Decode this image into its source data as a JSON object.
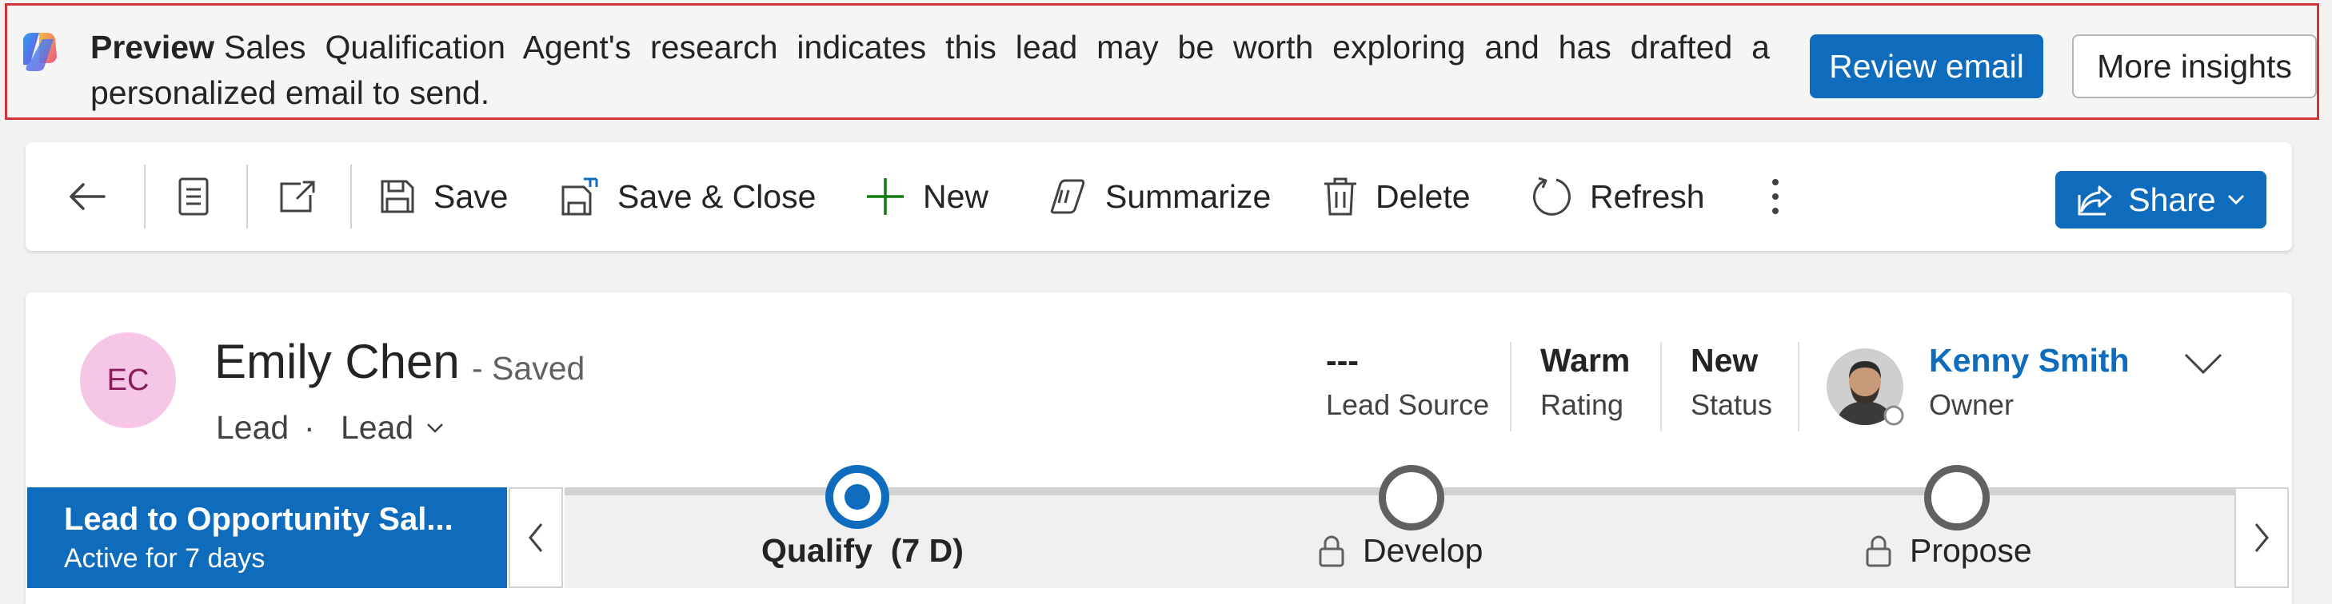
{
  "banner": {
    "prefix": "Preview",
    "message": "Sales Qualification Agent's research indicates this lead may be worth exploring and has drafted a personalized email to send.",
    "review_button": "Review email",
    "insights_button": "More insights"
  },
  "commandbar": {
    "save": "Save",
    "save_close": "Save & Close",
    "new": "New",
    "summarize": "Summarize",
    "delete": "Delete",
    "refresh": "Refresh",
    "share": "Share"
  },
  "record": {
    "initials": "EC",
    "name": "Emily Chen",
    "saved_status": "- Saved",
    "entity": "Lead",
    "separator": "·",
    "form": "Lead",
    "fields": [
      {
        "value": "---",
        "label": "Lead Source"
      },
      {
        "value": "Warm",
        "label": "Rating"
      },
      {
        "value": "New",
        "label": "Status"
      }
    ],
    "owner": {
      "name": "Kenny Smith",
      "label": "Owner"
    }
  },
  "bpf": {
    "title": "Lead to Opportunity Sal...",
    "subtitle": "Active for 7 days",
    "stages": [
      {
        "label": "Qualify  (7 D)",
        "active": true,
        "locked": false
      },
      {
        "label": "Develop",
        "active": false,
        "locked": true
      },
      {
        "label": "Propose",
        "active": false,
        "locked": true
      }
    ]
  },
  "colors": {
    "brand": "#0f6cbd",
    "banner_border": "#d13438",
    "avatar_bg": "#f5c6e6"
  }
}
